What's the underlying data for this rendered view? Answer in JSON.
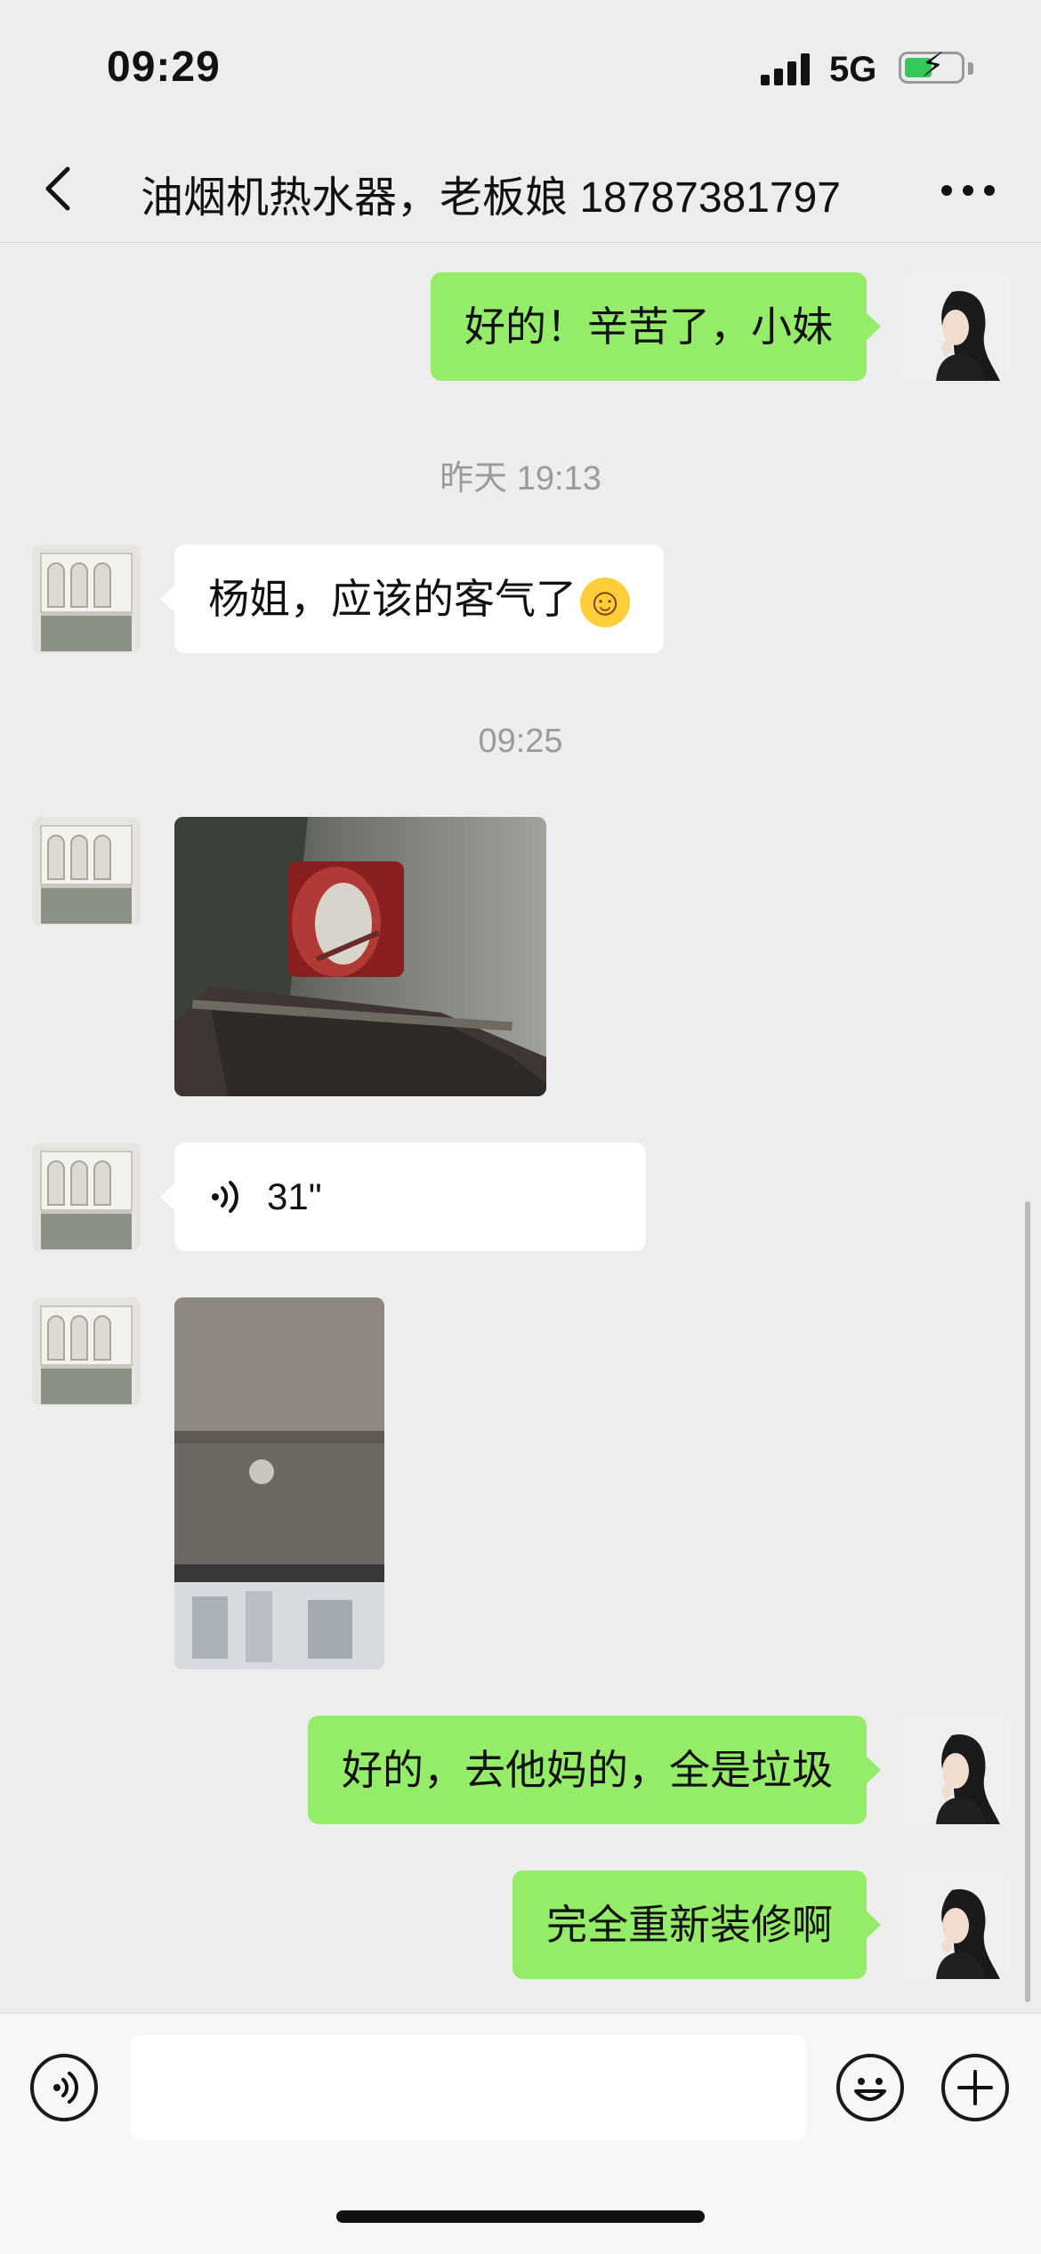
{
  "status_bar": {
    "time": "09:29",
    "network": "5G",
    "battery_color": "#34c759"
  },
  "nav": {
    "title": "油烟机热水器，老板娘 18787381797",
    "back_icon": "chevron-left-icon",
    "more_icon": "more-dots-icon"
  },
  "timestamps": [
    "昨天 19:13",
    "09:25"
  ],
  "messages": [
    {
      "side": "right",
      "type": "text",
      "text": "好的！辛苦了，小妹"
    },
    {
      "side": "left",
      "type": "text",
      "text": "杨姐，应该的客气了",
      "emoji": "☺"
    },
    {
      "side": "left",
      "type": "image",
      "description_icon": "photo-range-hood-vent"
    },
    {
      "side": "left",
      "type": "voice",
      "duration": "31\""
    },
    {
      "side": "left",
      "type": "image",
      "description_icon": "photo-ceiling-window"
    },
    {
      "side": "right",
      "type": "text",
      "text": "好的，去他妈的，全是垃圾"
    },
    {
      "side": "right",
      "type": "text",
      "text": "完全重新装修啊"
    }
  ],
  "input_bar": {
    "voice_icon": "voice-input-icon",
    "emoji_icon": "emoji-icon",
    "plus_icon": "plus-icon",
    "value": ""
  },
  "colors": {
    "background": "#ededed",
    "bubble_green": "#95ec69",
    "bubble_white": "#ffffff"
  }
}
